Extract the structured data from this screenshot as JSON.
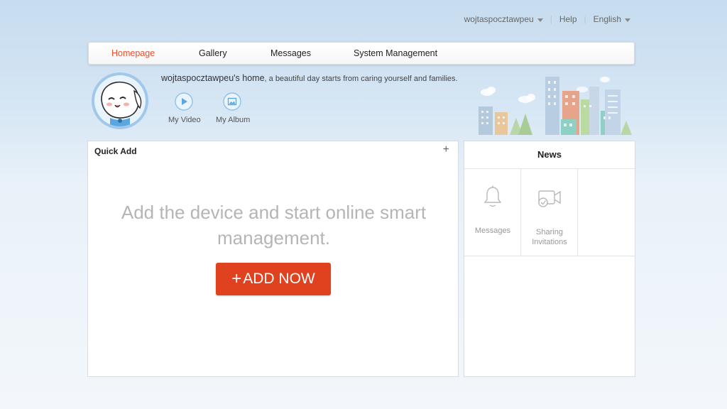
{
  "topbar": {
    "username": "wojtaspocztawpeu",
    "help": "Help",
    "language": "English",
    "separator": "|"
  },
  "nav": {
    "tabs": [
      {
        "label": "Homepage",
        "active": true
      },
      {
        "label": "Gallery",
        "active": false
      },
      {
        "label": "Messages",
        "active": false
      },
      {
        "label": "System Management",
        "active": false
      }
    ]
  },
  "profile": {
    "home_title": "wojtaspocztawpeu's home",
    "slogan": ", a beautiful day starts from caring yourself and families.",
    "links": [
      {
        "label": "My Video",
        "icon": "play-icon"
      },
      {
        "label": "My Album",
        "icon": "image-icon"
      }
    ]
  },
  "quick_add": {
    "title": "Quick Add",
    "plus_icon": "+",
    "empty_line1": "Add the device and start online smart",
    "empty_line2": "management.",
    "button_plus": "+",
    "button_label": "ADD NOW"
  },
  "news": {
    "title": "News",
    "items": [
      {
        "label": "Messages",
        "icon": "bell-icon"
      },
      {
        "label_line1": "Sharing",
        "label_line2": "Invitations",
        "icon": "camera-share-icon"
      }
    ]
  },
  "colors": {
    "accent": "#e8502f",
    "button": "#e0411f",
    "icon_blue": "#5aa6e0"
  }
}
